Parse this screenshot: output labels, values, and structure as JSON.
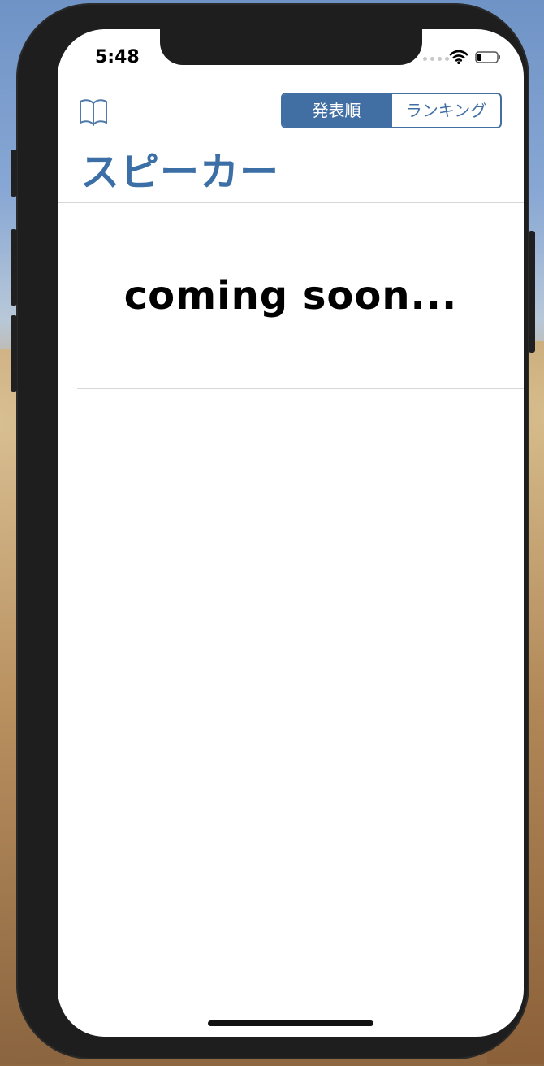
{
  "status_bar": {
    "time": "5:48"
  },
  "header": {
    "segments": [
      "発表順",
      "ランキング"
    ],
    "active_segment_index": 0,
    "title": "スピーカー"
  },
  "content": {
    "message": "coming soon..."
  },
  "icons": {
    "left_header_icon": "book-icon",
    "wifi": "wifi-icon",
    "battery": "battery-icon"
  },
  "colors": {
    "accent": "#426fa3",
    "title": "#3d6fa7",
    "background": "#ffffff",
    "text": "#000000",
    "divider": "#d8d8d8"
  }
}
